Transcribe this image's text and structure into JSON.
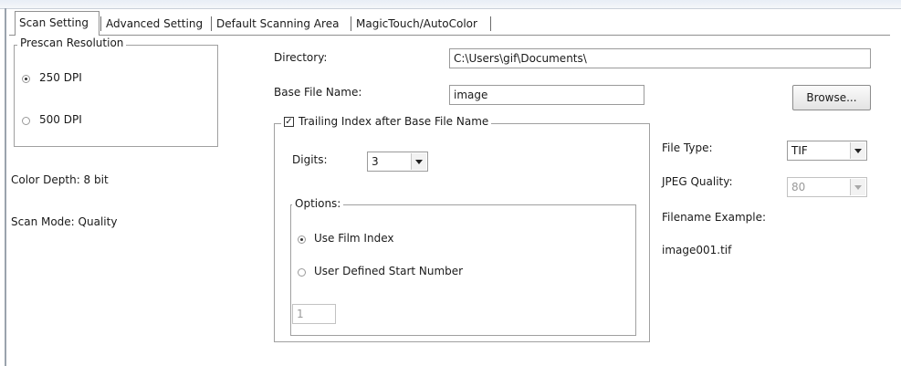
{
  "tabs": [
    {
      "label": "Scan Setting",
      "active": true
    },
    {
      "label": "Advanced Setting",
      "active": false
    },
    {
      "label": "Default Scanning Area",
      "active": false
    },
    {
      "label": "MagicTouch/AutoColor",
      "active": false
    }
  ],
  "prescan": {
    "title": "Prescan Resolution",
    "options": [
      {
        "label": "250 DPI",
        "selected": true
      },
      {
        "label": "500 DPI",
        "selected": false
      }
    ]
  },
  "info": {
    "color_depth": "Color Depth: 8 bit",
    "scan_mode": "Scan Mode: Quality"
  },
  "directory": {
    "label": "Directory:",
    "value": "C:\\Users\\gif\\Documents\\"
  },
  "base_file": {
    "label": "Base File Name:",
    "value": "image",
    "browse_label": "Browse..."
  },
  "trailing_index": {
    "label": "Trailing Index after Base File Name",
    "checked": true,
    "digits_label": "Digits:",
    "digits_value": "3",
    "options_title": "Options:",
    "options": [
      {
        "label": "Use Film Index",
        "selected": true
      },
      {
        "label": "User Defined Start Number",
        "selected": false
      }
    ],
    "start_number_value": "1"
  },
  "file_type": {
    "label": "File Type:",
    "value": "TIF"
  },
  "jpeg_quality": {
    "label": "JPEG Quality:",
    "value": "80"
  },
  "filename_example": {
    "label": "Filename Example:",
    "value": "image001.tif"
  },
  "colors": {
    "frame_border": "#a0a0a0",
    "disabled_text": "#9a9a9a"
  },
  "icons": {
    "checkbox_checked": "check-mark",
    "combo_arrow": "chevron-down-icon",
    "radio_on": "radio-dot"
  }
}
